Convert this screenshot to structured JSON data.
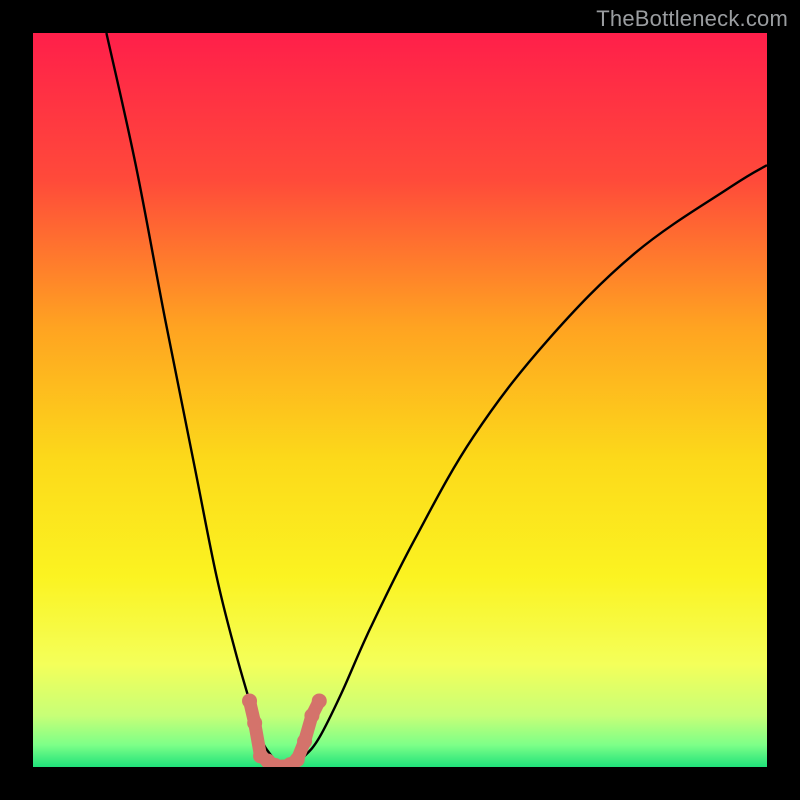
{
  "watermark_text": "TheBottleneck.com",
  "colors": {
    "frame": "#000000",
    "gradient_stops": [
      {
        "offset": 0.0,
        "color": "#ff1f4a"
      },
      {
        "offset": 0.2,
        "color": "#ff4a3a"
      },
      {
        "offset": 0.4,
        "color": "#ffa321"
      },
      {
        "offset": 0.58,
        "color": "#fcd91a"
      },
      {
        "offset": 0.74,
        "color": "#fbf321"
      },
      {
        "offset": 0.86,
        "color": "#f4ff5a"
      },
      {
        "offset": 0.93,
        "color": "#c7ff77"
      },
      {
        "offset": 0.97,
        "color": "#7dff88"
      },
      {
        "offset": 1.0,
        "color": "#20e27a"
      }
    ],
    "curve": "#000000",
    "marker": "#d4736b"
  },
  "chart_data": {
    "type": "line",
    "title": "",
    "xlabel": "",
    "ylabel": "",
    "xlim": [
      0,
      100
    ],
    "ylim": [
      0,
      100
    ],
    "grid": false,
    "series": [
      {
        "name": "bottleneck-curve",
        "x": [
          10,
          14,
          18,
          22,
          25,
          27.5,
          29.5,
          31,
          32.5,
          34,
          35.5,
          37,
          39,
          42,
          46,
          52,
          60,
          70,
          82,
          95,
          100
        ],
        "values": [
          100,
          82,
          61,
          41,
          26,
          16,
          9,
          4,
          1.5,
          0,
          0.5,
          1.5,
          4,
          10,
          19,
          31,
          45,
          58,
          70,
          79,
          82
        ]
      }
    ],
    "markers": {
      "name": "low-bottleneck-band",
      "x_start": 29.5,
      "x_end": 39.0,
      "y_max": 10,
      "points": [
        {
          "x": 29.5,
          "y": 9.0
        },
        {
          "x": 30.2,
          "y": 6.0
        },
        {
          "x": 31.0,
          "y": 1.5
        },
        {
          "x": 32.0,
          "y": 0.8
        },
        {
          "x": 33.0,
          "y": 0.2
        },
        {
          "x": 34.0,
          "y": 0.0
        },
        {
          "x": 35.0,
          "y": 0.3
        },
        {
          "x": 36.0,
          "y": 1.0
        },
        {
          "x": 37.0,
          "y": 3.5
        },
        {
          "x": 38.0,
          "y": 7.0
        },
        {
          "x": 39.0,
          "y": 9.0
        }
      ]
    }
  }
}
